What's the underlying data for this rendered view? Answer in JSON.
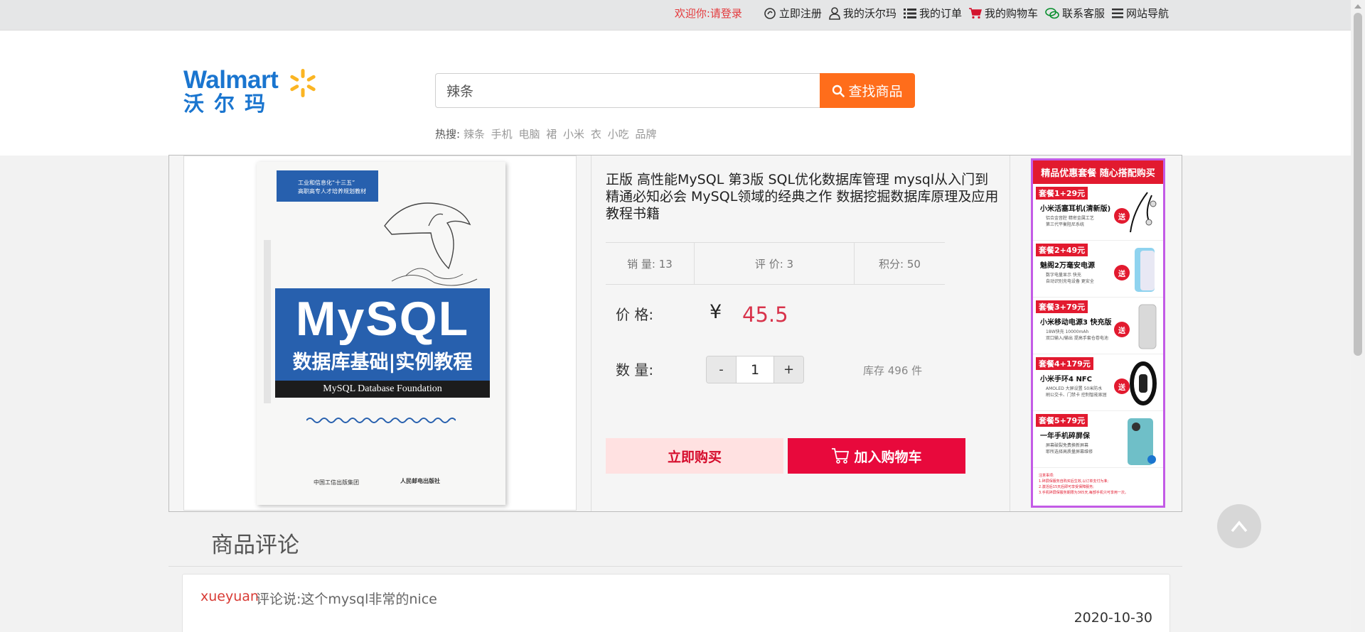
{
  "topbar": {
    "welcome": "欢迎你:",
    "login": "请登录",
    "links": [
      {
        "label": "立即注册",
        "icon": "register-icon"
      },
      {
        "label": "我的沃尔玛",
        "icon": "user-icon"
      },
      {
        "label": "我的订单",
        "icon": "list-icon"
      },
      {
        "label": "我的购物车",
        "icon": "cart-icon"
      },
      {
        "label": "联系客服",
        "icon": "chat-icon"
      },
      {
        "label": "网站导航",
        "icon": "menu-icon"
      }
    ]
  },
  "header": {
    "logo_text": "Walmart",
    "logo_cn": "沃尔玛",
    "search_value": "辣条",
    "search_button": "查找商品",
    "hot_label": "热搜:",
    "hot_keywords": [
      "辣条",
      "手机",
      "电脑",
      "裙",
      "小米",
      "衣",
      "小吃",
      "品牌"
    ]
  },
  "product": {
    "cover": {
      "badge_line1": "工业和信息化“十三五”",
      "badge_line2": "高职高专人才培养规划教材",
      "title": "MySQL",
      "subtitle": "数据库基础|实例教程",
      "english": "MySQL Database Foundation",
      "publisher1": "中国工信出版集团",
      "publisher2": "人民邮电出版社"
    },
    "title": "正版 高性能MySQL 第3版 SQL优化数据库管理 mysql从入门到精通必知必会 MySQL领域的经典之作 数据挖掘数据库原理及应用教程书籍",
    "sales": "销 量: 13",
    "reviews": "评 价: 3",
    "points": "积分: 50",
    "price_label": "价 格:",
    "currency": "¥",
    "price": "45.5",
    "qty_label": "数 量:",
    "qty_minus": "-",
    "qty_value": "1",
    "qty_plus": "+",
    "stock": "库存 496 件",
    "buy_now": "立即购买",
    "add_cart": "加入购物车"
  },
  "promo": {
    "header": "精品优惠套餐 随心搭配购买",
    "send": "送",
    "items": [
      {
        "tag": "套餐1+29元",
        "name": "小米活塞耳机(清新版)",
        "desc1": "铝合金音腔 精密金属工艺",
        "desc2": "第三代平衡阻尼系统"
      },
      {
        "tag": "套餐2+49元",
        "name": "魅阁2万毫安电源",
        "desc1": "数字电量显示 快充",
        "desc2": "自动识别充电设备 更安全"
      },
      {
        "tag": "套餐3+79元",
        "name": "小米移动电源3 快充版",
        "desc1": "18W快充 10000mAh",
        "desc2": "双口输入/输出 提高手套仓卷电池"
      },
      {
        "tag": "套餐4+179元",
        "name": "小米手环4 NFC",
        "desc1": "AMOLED 大屏设置 50米防水",
        "desc2": "刷公交卡、门禁卡 控制智能家居"
      },
      {
        "tag": "套餐5+79元",
        "name": "一年手机碎屏保",
        "desc1": "屏幕破裂免费换新屏幕",
        "desc2": "耶所选择高质量屏幕维修"
      }
    ],
    "note_title": "注意事项:",
    "note1": "1.碎屏保服务自购买后生效,以订单支付为准;",
    "note2": "2.激活后15天后即可享受保障服务;",
    "note3": "3.手机碎屏保服务期限为365天,每部手机只可享用一次。"
  },
  "reviews": {
    "section_title": "商品评论",
    "items": [
      {
        "user": "xueyuan",
        "text": "评论说:这个mysql非常的nice",
        "date": "2020-10-30"
      }
    ]
  },
  "totop": "^"
}
